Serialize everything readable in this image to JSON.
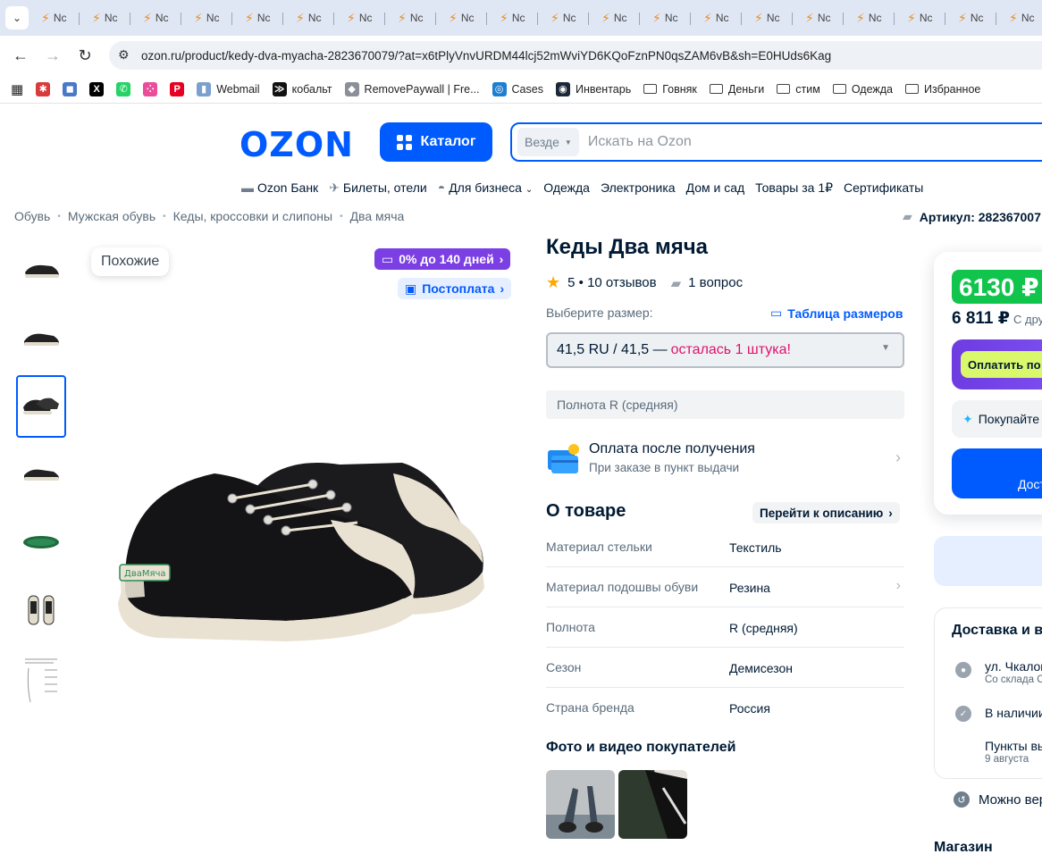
{
  "browser": {
    "tab_label": "Nc",
    "tab_count": 20,
    "url": "ozon.ru/product/kedy-dva-myacha-2823670079/?at=x6tPlyVnvURDM44lcj52mWviYD6KQoFznPN0qsZAM6vB&sh=E0HUds6Kag",
    "bookmarks": [
      {
        "label": "",
        "icon": "puzzle-icon"
      },
      {
        "label": "",
        "icon": "app-icon"
      },
      {
        "label": "",
        "icon": "x-icon"
      },
      {
        "label": "",
        "icon": "whatsapp-icon"
      },
      {
        "label": "",
        "icon": "dots-icon"
      },
      {
        "label": "",
        "icon": "pinterest-icon"
      },
      {
        "label": "Webmail",
        "icon": "webmail-icon"
      },
      {
        "label": "кобальт",
        "icon": "terminal-icon"
      },
      {
        "label": "RemovePaywall | Fre...",
        "icon": "diamond-icon"
      },
      {
        "label": "Cases",
        "icon": "cases-icon"
      },
      {
        "label": "Инвентарь",
        "icon": "steam-icon"
      },
      {
        "label": "Говняк",
        "icon": "folder-icon"
      },
      {
        "label": "Деньги",
        "icon": "folder-icon"
      },
      {
        "label": "стим",
        "icon": "folder-icon"
      },
      {
        "label": "Одежда",
        "icon": "folder-icon"
      },
      {
        "label": "Избранное",
        "icon": "folder-icon"
      }
    ]
  },
  "header": {
    "logo": "OZON",
    "catalog_label": "Каталог",
    "search_scope": "Везде",
    "search_placeholder": "Искать на Ozon",
    "nav": [
      "Ozon Банк",
      "Билеты, отели",
      "Для бизнеса",
      "Одежда",
      "Электроника",
      "Дом и сад",
      "Товары за 1₽",
      "Сертификаты"
    ]
  },
  "breadcrumb": [
    "Обувь",
    "Мужская обувь",
    "Кеды, кроссовки и слипоны",
    "Два мяча"
  ],
  "article_label": "Артикул: 282367007",
  "gallery": {
    "similar_label": "Похожие",
    "badge_credit": "0% до 140 дней",
    "badge_postpay": "Постоплата"
  },
  "product": {
    "title": "Кеды Два мяча",
    "rating": "5",
    "reviews": "10 отзывов",
    "questions": "1 вопрос",
    "size_label": "Выберите размер:",
    "size_table_label": "Таблица размеров",
    "size_selected": "41,5 RU / 41,5 —",
    "size_warning": "осталась 1 штука!",
    "fullness": "Полнота R (средняя)",
    "paylater_title": "Оплата после получения",
    "paylater_sub": "При заказе в пункт выдачи",
    "about_title": "О товаре",
    "goto_description": "Перейти к описанию",
    "specs": [
      {
        "key": "Материал стельки",
        "value": "Текстиль"
      },
      {
        "key": "Материал подошвы обуви",
        "value": "Резина"
      },
      {
        "key": "Полнота",
        "value": "R (средняя)"
      },
      {
        "key": "Сезон",
        "value": "Демисезон"
      },
      {
        "key": "Страна бренда",
        "value": "Россия"
      }
    ],
    "photos_title": "Фото и видео покупателей"
  },
  "buy": {
    "price": "6130 ₽",
    "old_price": "6 811 ₽",
    "old_price_note": "С дру",
    "pay_button": "Оплатить по",
    "promo": "Покупайте",
    "cta": "Дост"
  },
  "delivery": {
    "title": "Доставка и в",
    "address": "ул. Чкалов",
    "address_sub": "Со склада О",
    "stock": "В наличии",
    "pickup": "Пункты вы",
    "pickup_date": "9 августа",
    "return": "Можно вер",
    "stores": "Магазин"
  },
  "colors": {
    "accent": "#005bff",
    "green": "#10c44c",
    "purple": "#7b3fe4",
    "warning": "#e0116c"
  }
}
